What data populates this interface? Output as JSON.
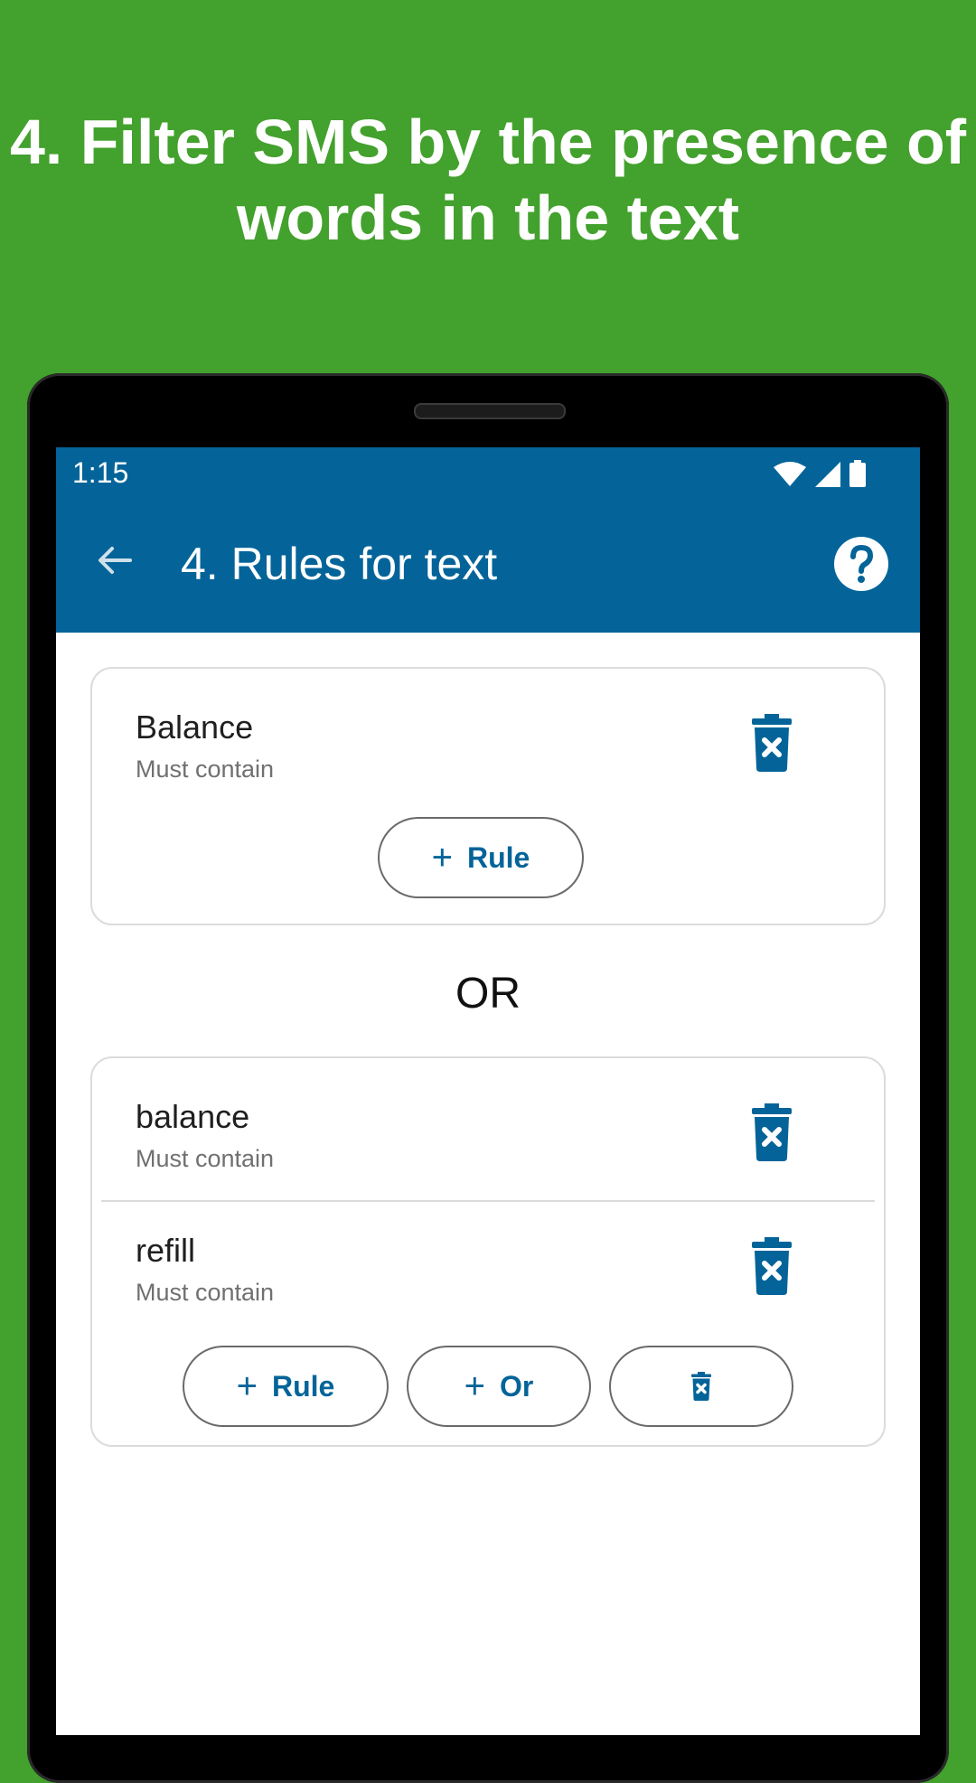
{
  "headline": {
    "line1": "4. Filter SMS by the presence of",
    "line2": "words in the text"
  },
  "status_bar": {
    "time": "1:15",
    "icons": [
      "wifi-icon",
      "signal-icon",
      "battery-icon"
    ]
  },
  "app_bar": {
    "title": "4. Rules for text",
    "back_icon": "arrow-back-icon",
    "help_icon": "help-icon",
    "color": "#046499"
  },
  "groups": [
    {
      "rules": [
        {
          "word": "Balance",
          "condition": "Must contain"
        }
      ],
      "buttons": {
        "add_rule": "Rule"
      }
    },
    {
      "rules": [
        {
          "word": "balance",
          "condition": "Must contain"
        },
        {
          "word": "refill",
          "condition": "Must contain"
        }
      ],
      "buttons": {
        "add_rule": "Rule",
        "add_or": "Or"
      }
    }
  ],
  "separator": "OR",
  "colors": {
    "background": "#43a12d",
    "accent": "#046499"
  }
}
